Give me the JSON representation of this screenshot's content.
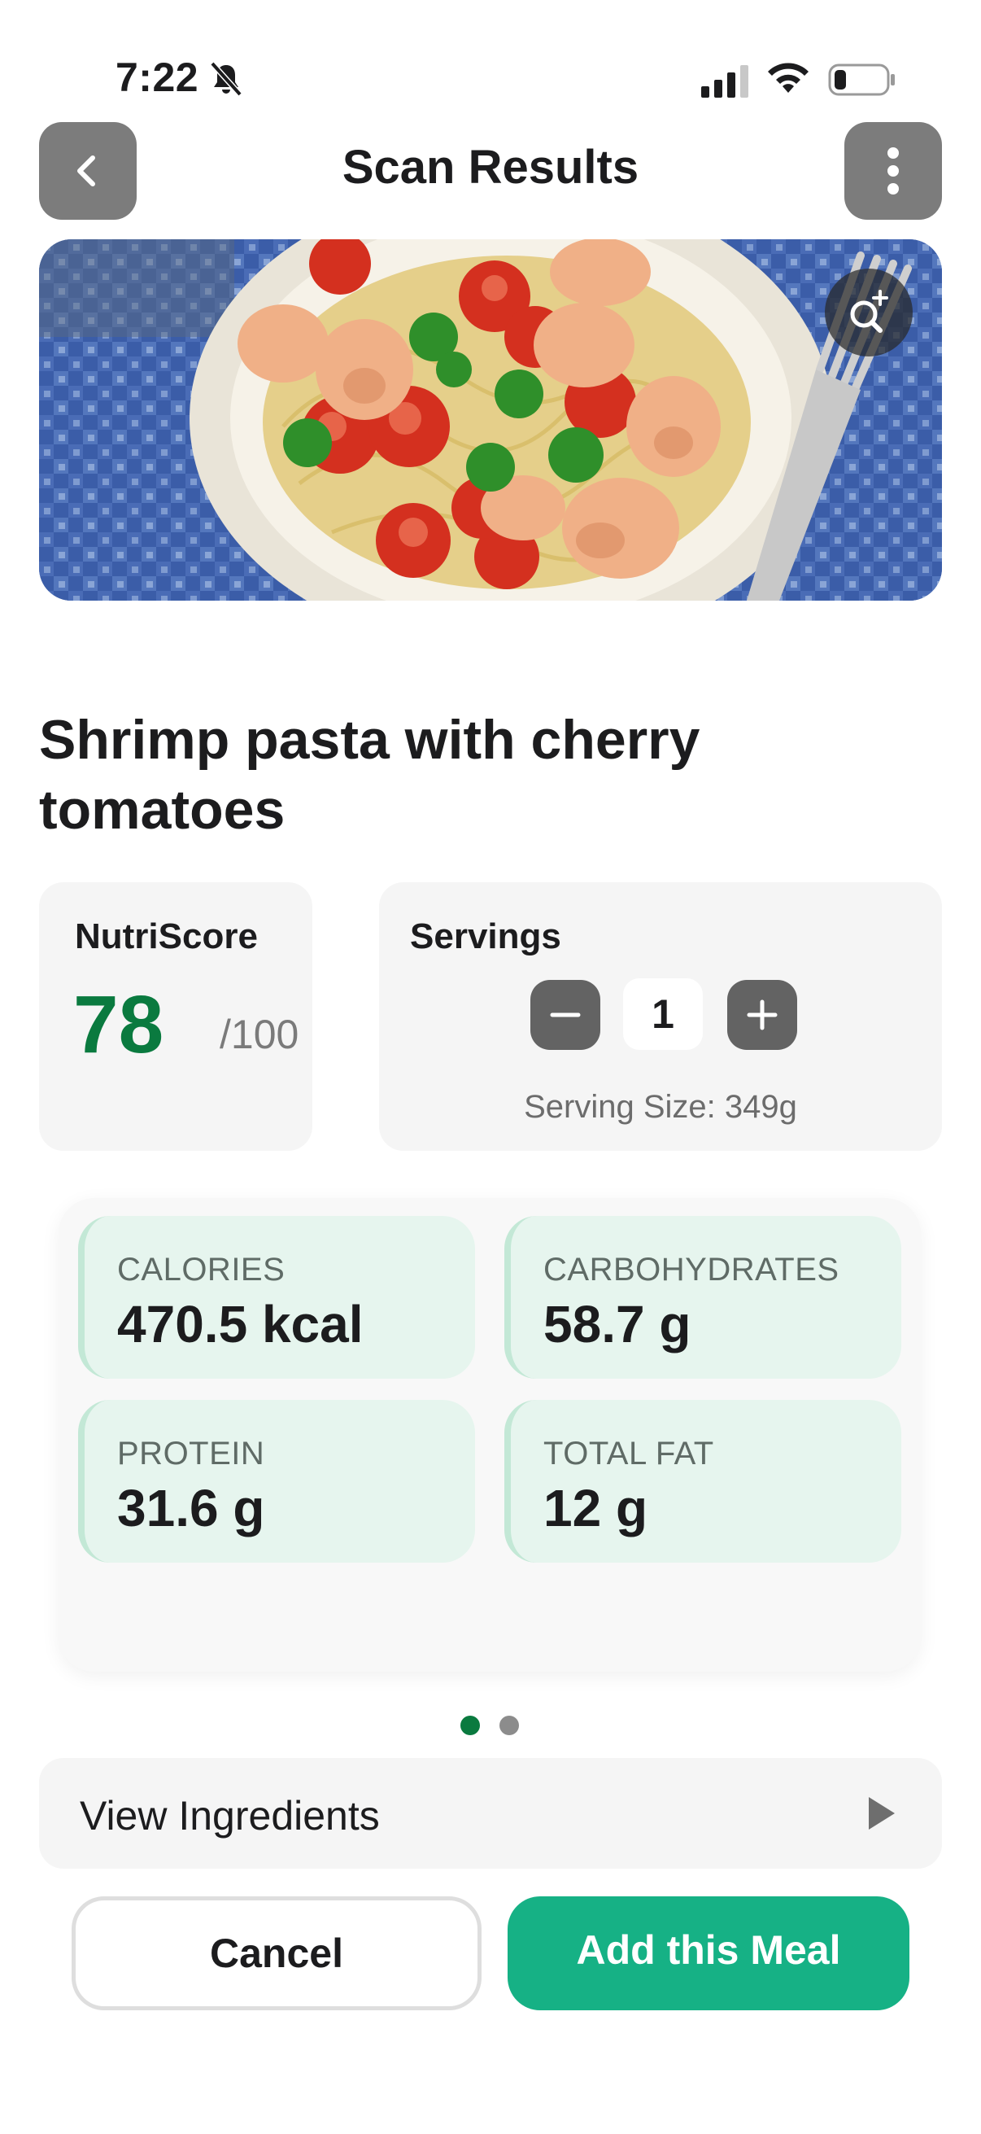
{
  "status_bar": {
    "time": "7:22",
    "icons": [
      "bell-slash-icon",
      "signal-icon",
      "wifi-icon",
      "battery-icon"
    ]
  },
  "header": {
    "title": "Scan Results",
    "back_icon": "chevron-left-icon",
    "more_icon": "ellipsis-vertical-icon"
  },
  "hero": {
    "zoom_icon": "zoom-in-icon"
  },
  "meal": {
    "name": "Shrimp pasta with cherry tomatoes"
  },
  "nutriscore": {
    "label": "NutriScore",
    "value": "78",
    "max": "/100"
  },
  "servings": {
    "label": "Servings",
    "count": "1",
    "size": "Serving Size: 349g"
  },
  "macros": [
    {
      "label": "CALORIES",
      "value": "470.5 kcal"
    },
    {
      "label": "CARBOHYDRATES",
      "value": "58.7 g"
    },
    {
      "label": "PROTEIN",
      "value": "31.6 g"
    },
    {
      "label": "TOTAL FAT",
      "value": "12 g"
    }
  ],
  "pagination": {
    "total": 2,
    "active": 1
  },
  "ingredients": {
    "label": "View Ingredients"
  },
  "actions": {
    "cancel_label": "Cancel",
    "add_label": "Add this Meal"
  },
  "colors": {
    "accent_green": "#0a7a3f",
    "primary_button": "#16b185",
    "macro_tile": "#e6f5ee"
  }
}
